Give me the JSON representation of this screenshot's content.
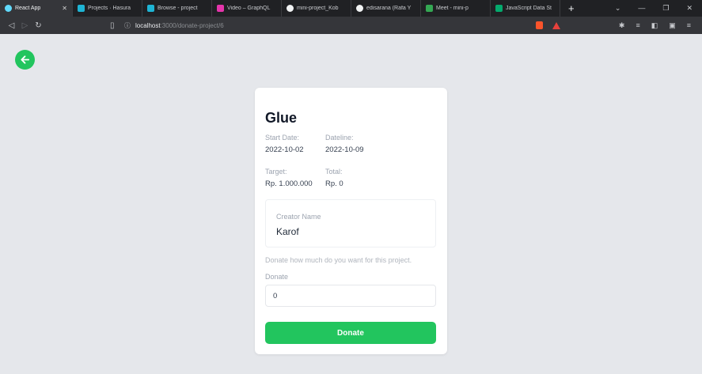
{
  "browser": {
    "tabs": [
      {
        "label": "React App",
        "icon": "react-icon",
        "color": "#61dafb",
        "active": true
      },
      {
        "label": "Projects · Hasura",
        "icon": "hasura-icon",
        "color": "#1eb4d4",
        "active": false
      },
      {
        "label": "Browse - project",
        "icon": "hasura-icon",
        "color": "#1eb4d4",
        "active": false
      },
      {
        "label": "Video – GraphQL",
        "icon": "video-icon",
        "color": "#e535ab",
        "active": false
      },
      {
        "label": "mini-project_Kob",
        "icon": "github-icon",
        "color": "#f1f3f4",
        "active": false
      },
      {
        "label": "edisarana (Rafa Y",
        "icon": "github-icon",
        "color": "#f1f3f4",
        "active": false
      },
      {
        "label": "Meet - mini-p",
        "icon": "meet-icon",
        "color": "#34a853",
        "active": false
      },
      {
        "label": "JavaScript Data St",
        "icon": "w3schools-icon",
        "color": "#04aa6d",
        "active": false
      }
    ],
    "new_tab": "+",
    "window_controls": [
      "⌄",
      "—",
      "❐",
      "✕"
    ],
    "url_host": "localhost",
    "url_path": ":3000/donate-project/6"
  },
  "project": {
    "title": "Glue",
    "start_date_label": "Start Date:",
    "start_date": "2022-10-02",
    "deadline_label": "Dateline:",
    "deadline": "2022-10-09",
    "target_label": "Target:",
    "target": "Rp. 1.000.000",
    "total_label": "Total:",
    "total": "Rp. 0",
    "creator_label": "Creator Name",
    "creator": "Karof"
  },
  "donate": {
    "hint": "Donate how much do you want for this project.",
    "label": "Donate",
    "value": "0",
    "button": "Donate"
  },
  "colors": {
    "accent": "#22c55e",
    "page_bg": "#e5e7eb"
  }
}
